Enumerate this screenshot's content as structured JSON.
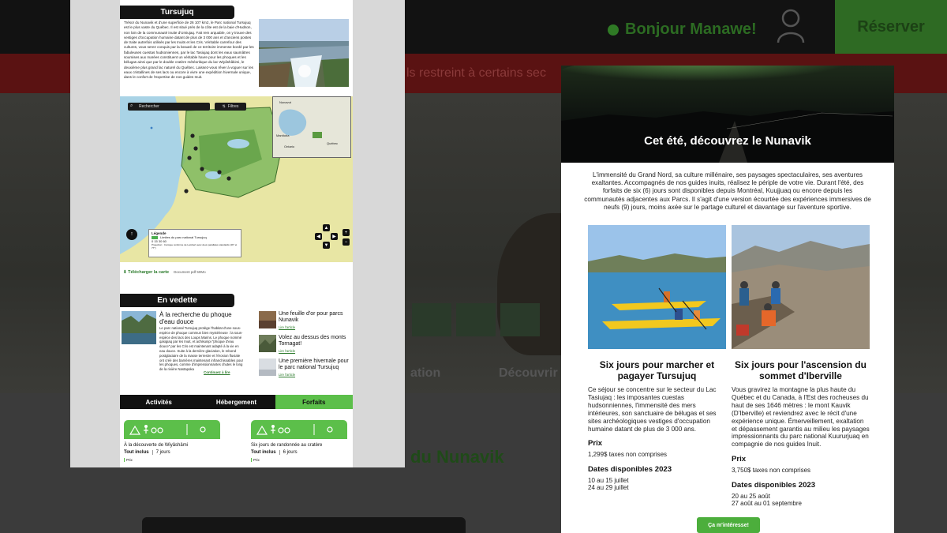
{
  "background": {
    "greeting": "Bonjour Manawe!",
    "reserve_button": "Réserver",
    "banner_text": "ls restreint à certains sec",
    "tab_labels": [
      "ation",
      "Découvrir"
    ],
    "section_title": "du Nunavik"
  },
  "left_page": {
    "park_title": "Tursujuq",
    "intro": "Trésor du Nunavik et d'une superficie de 26 107 km2, le Parc national Tursujuq est le plus vaste du Québec. Il est situé près de la côte est de la baie d'Hudson, non loin de la communauté inuite d'Umiujaq. Fait rem arquable, on y trouve des vestiges d'occupation humaine datant de plus de 3 000 ans et d'anciens postes de traite autrefois utilisés par les Inuits et les Cris. Véritable carrefour des cultures, vous serez conquis par la beauté de ce territoire immense bordé par les fabuleuses cuestas hudsoniennes, par le lac Tasiujaq dont les eaux saumâtres soumises aux marées constituent un véritable havre pour les phoques et les bélugas ainsi que par le double cratère météoritique du lac Wiyâshâkimi, le deuxième plus grand lac naturel du Québec. Laissez-vous rêver à voguer sur les eaux cristallines de ses lacs ou encore à vivre une expédition hivernale unique, dans le confort de l'expertise de nos guides Inuit.",
    "map": {
      "search_placeholder": "Rechercher",
      "filter_label": "Filtres",
      "inset_labels": [
        "Nunavut",
        "Manitoba",
        "Ontario",
        "Québec"
      ],
      "legend_title": "Légende",
      "legend_item": "Limites du parc national Tursujuq",
      "legend_scale": "0   15   30   60",
      "legend_note": "Projection : Conique conforme de Lambert avec deux parallèles standards (49° et 77°)"
    },
    "download_label": "Télécharger la carte",
    "download_meta": "Document pdf 50Mo",
    "featured_title": "En vedette",
    "featured_article": {
      "title": "À la recherche du phoque d'eau douce",
      "text": "Le parc national Tursujuq protège l'habitat d'une sous-espèce de phoque commun bien mystérieuse : la sous-espèce des lacs des Loups Marins. Le phoque nommé qasigiaq par les Inuit, et achikunipi \"phoque d'eau douce\" par les Cris est maintenant adapté à la vie en eau douce. Suite à la dernière glaciation, le rebond postglaciaire de la masse terrestre et l'érosion fluviale ont créé des barrières maintenant infranchissables pour les phoques, comme d'impressionnantes chutes le long de la rivière Nastapoka",
      "more": "Continuez à lire"
    },
    "articles": [
      {
        "title": "Une feuille d'or pour parcs Nunavik",
        "link": "Lire l'article"
      },
      {
        "title": "Volez au dessus des monts Tornagat!",
        "link": "Lire l'article"
      },
      {
        "title": "Une première hivernale pour le parc national Tursujuq",
        "link": "Lire l'article"
      }
    ],
    "tabs": [
      "Activités",
      "Hébergement",
      "Forfaits"
    ],
    "active_tab": "Forfaits",
    "cards": [
      {
        "title": "À la découverte de Wiyâshâmi",
        "inclusion": "Tout inclus",
        "duration": "7 jours",
        "price_label": "Prix"
      },
      {
        "title": "Six jours de randonnée au cratère",
        "inclusion": "Tout inclus",
        "duration": "6 jours",
        "price_label": "Prix"
      }
    ]
  },
  "modal": {
    "title": "Cet été, découvrez le Nunavik",
    "intro": "L'immensité du Grand Nord, sa culture millénaire, ses paysages spectaculaires, ses aventures exaltantes. Accompagnés de nos guides inuits, réalisez le périple de votre vie. Durant l'été, des forfaits de six (6) jours sont disponibles depuis Montréal, Kuujjuaq ou encore depuis les communautés adjacentes aux Parcs. Il s'agit d'une version écourtée des expériences immersives de neufs (9) jours, moins axée sur le partage culturel et davantage sur l'aventure sportive.",
    "offers": [
      {
        "title": "Six jours pour marcher et pagayer Tursujuq",
        "description": "Ce séjour se concentre sur le secteur du Lac Tasiujaq : les imposantes cuestas hudsonniennes, l'immensité des mers intérieures, son sanctuaire de bélugas et ses sites archéologiques vestiges d'occupation humaine datant de plus de 3 000 ans.",
        "price_label": "Prix",
        "price": "1,299$ taxes non comprises",
        "dates_label": "Dates disponibles 2023",
        "dates": [
          "10 au 15 juillet",
          "24 au 29 juillet"
        ]
      },
      {
        "title": "Six jours pour l'ascension du sommet d'Iberville",
        "description": "Vous gravirez la montagne la plus haute du Québec et du Canada, à l'Est des rocheuses du haut de ses 1646 mètres : le mont Kauvik (D'Iberville) et reviendrez avec le récit d'une expérience unique. Émerveillement, exaltation et dépassement garantis au milieu les paysages impressionnants du parc national Kuururjuaq en compagnie de nos guides Inuit.",
        "price_label": "Prix",
        "price": "3,750$ taxes non comprises",
        "dates_label": "Dates disponibles 2023",
        "dates": [
          "20 au 25 août",
          "27 août au 01 septembre"
        ]
      }
    ],
    "cta": "Ça m'intéresse!"
  }
}
